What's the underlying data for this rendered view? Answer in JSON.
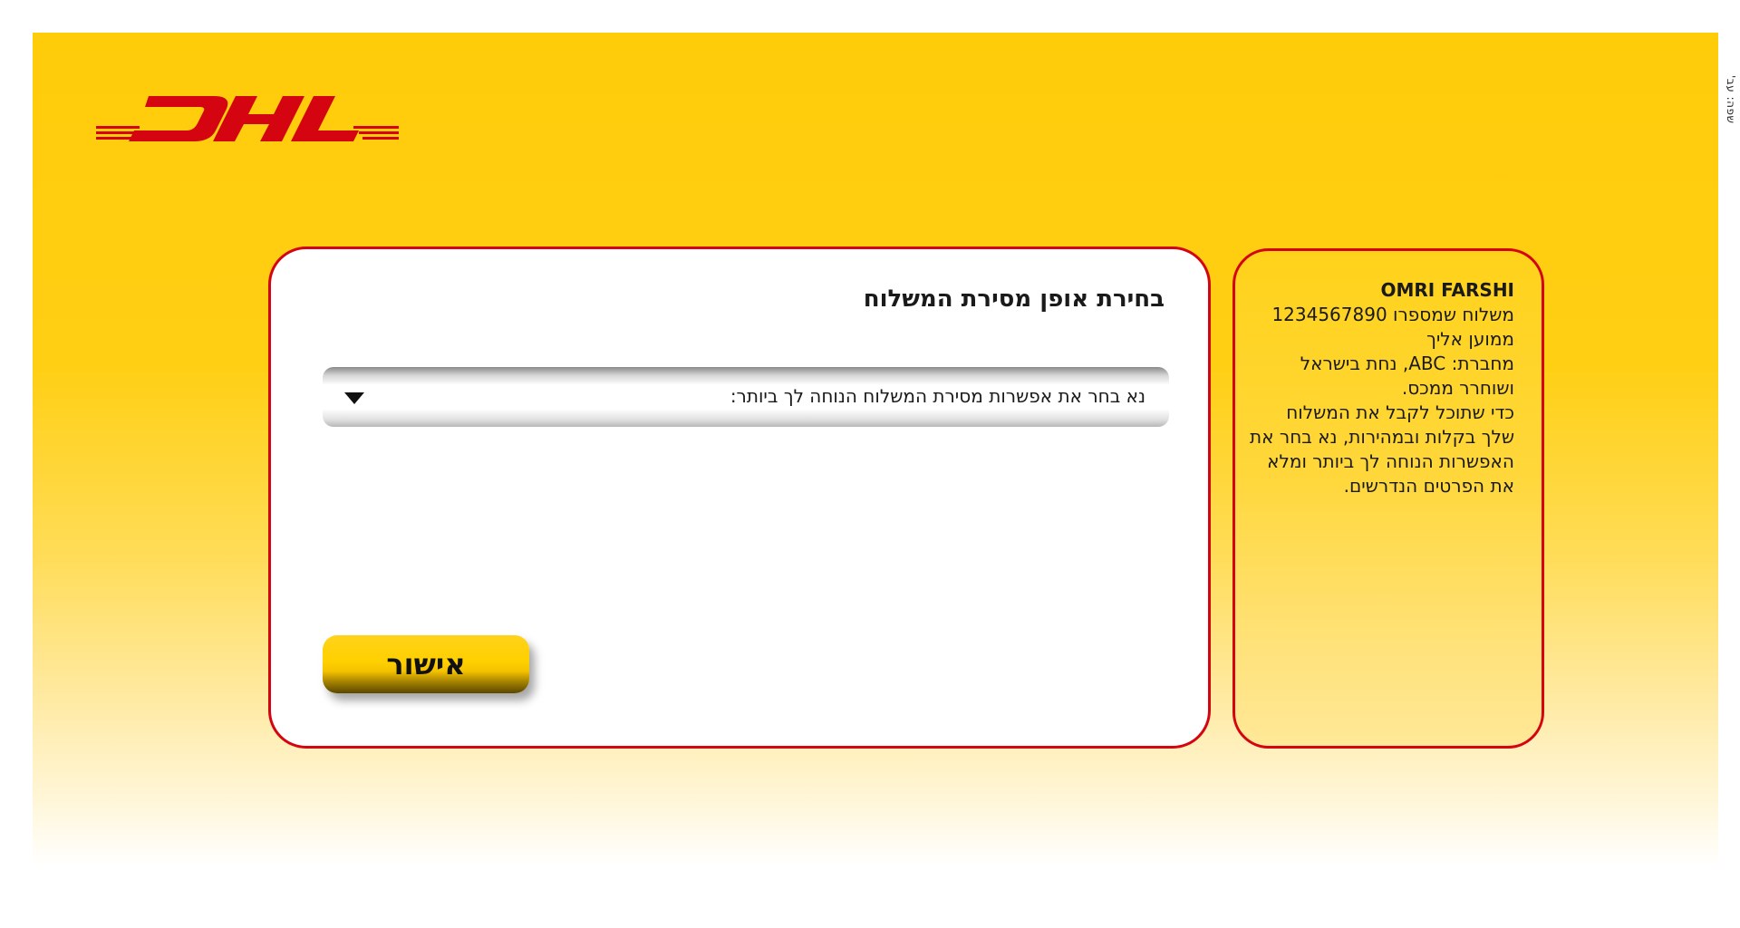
{
  "brand": {
    "logo_text": "DHL",
    "primary_color": "#ffcc00",
    "accent_color": "#d40511"
  },
  "side_tab": {
    "label": "שפה: עב'"
  },
  "main": {
    "title": "בחירת אופן מסירת המשלוח",
    "select": {
      "selected_text": "נא בחר את אפשרות מסירת המשלוח הנוחה לך ביותר:",
      "arrow_icon": "triangle-down-icon"
    },
    "confirm_button_label": "אישור"
  },
  "info": {
    "name": "OMRI FARSHI",
    "lines": [
      "משלוח שמספרו 1234567890",
      "ממוען אליך",
      "מחברת: ABC, נחת בישראל",
      "ושוחרר ממכס.",
      "כדי שתוכל לקבל את המשלוח",
      "שלך בקלות ובמהירות, נא בחר את",
      "האפשרות הנוחה לך ביותר ומלא",
      "את הפרטים הנדרשים."
    ]
  }
}
